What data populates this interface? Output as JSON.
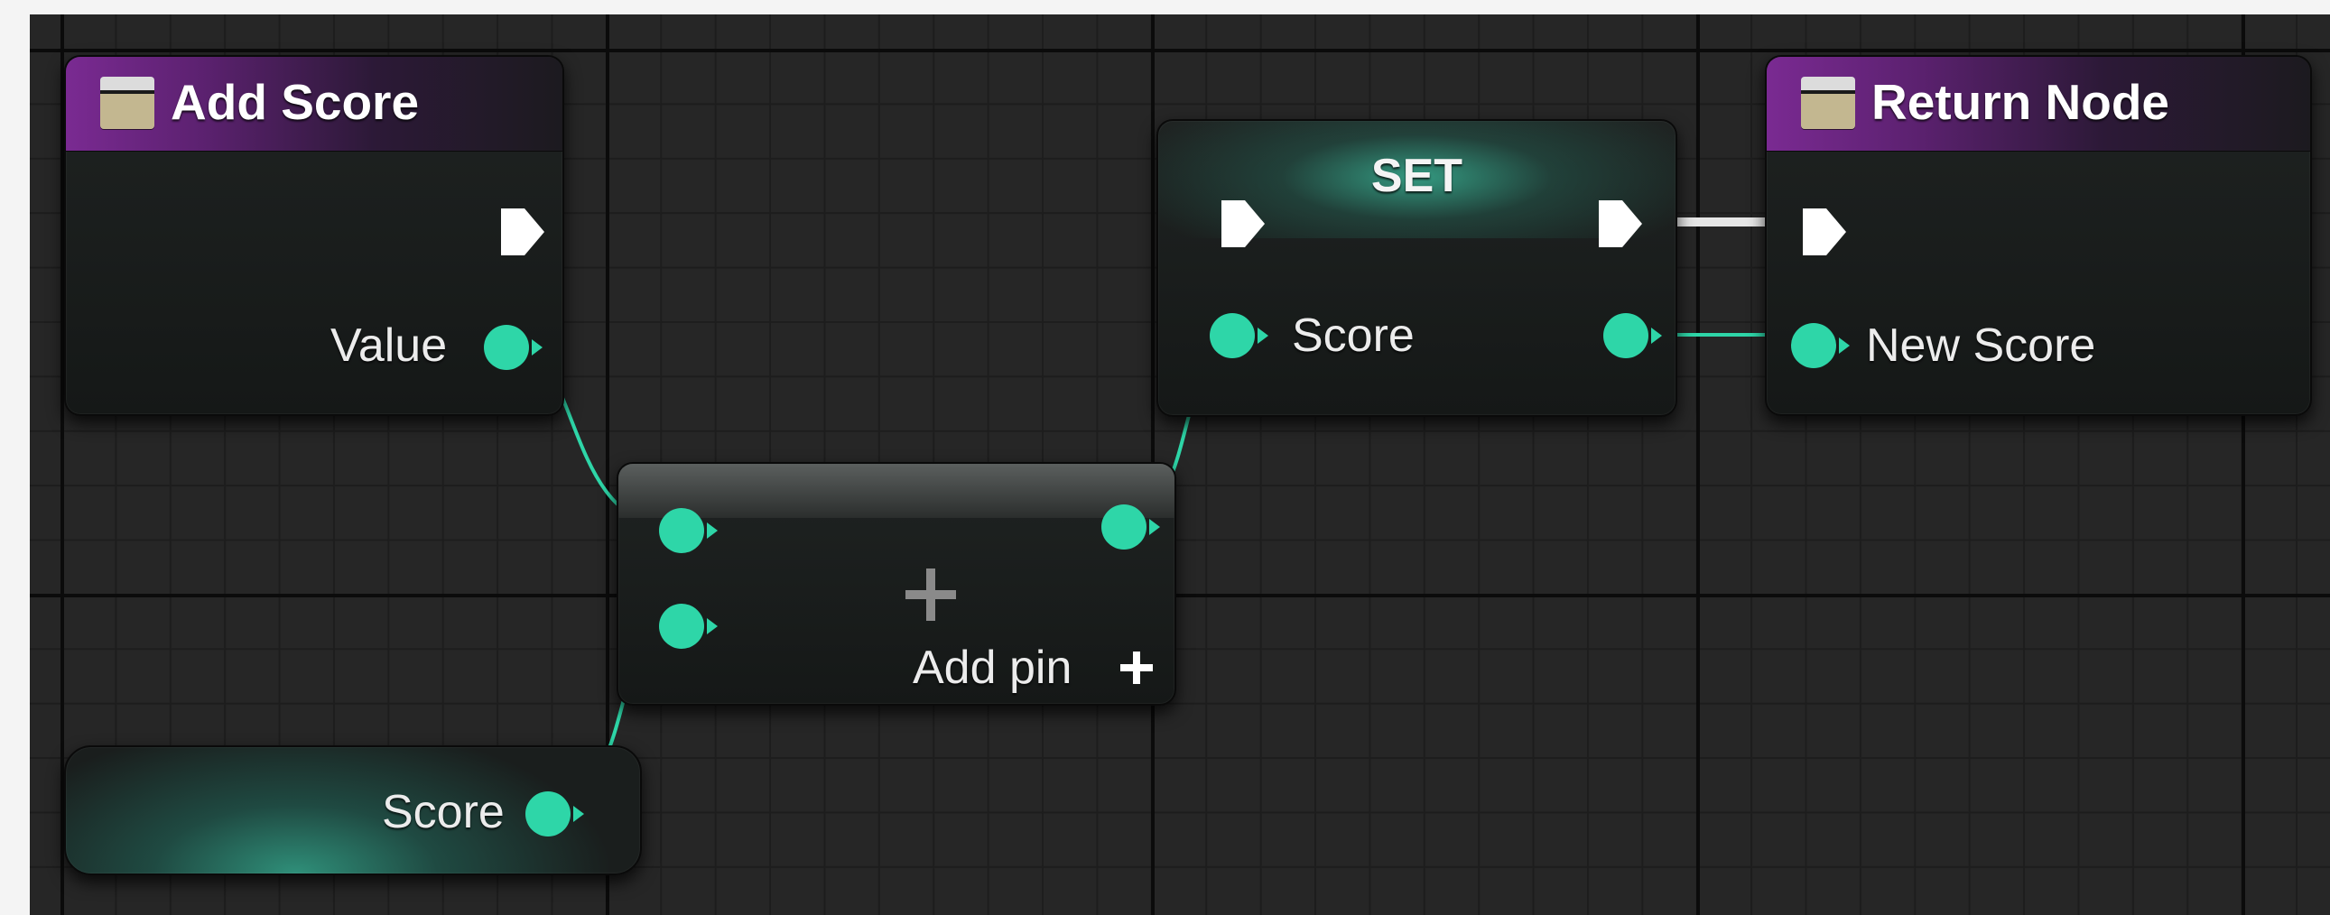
{
  "graph": {
    "nodes": {
      "add_score": {
        "title": "Add Score",
        "icon": "function-icon",
        "pins": {
          "value": "Value"
        }
      },
      "set": {
        "title": "SET",
        "pins": {
          "score": "Score"
        }
      },
      "add": {
        "symbol": "+",
        "add_pin_label": "Add pin",
        "add_pin_icon": "plus-icon"
      },
      "get_score": {
        "label": "Score"
      },
      "return_node": {
        "title": "Return Node",
        "icon": "function-icon",
        "pins": {
          "new_score": "New Score"
        }
      }
    },
    "colors": {
      "grid_background": "#262626",
      "function_header": "#7a2a92",
      "data_pin": "#2ed6a8",
      "exec_pin": "#ffffff"
    }
  }
}
